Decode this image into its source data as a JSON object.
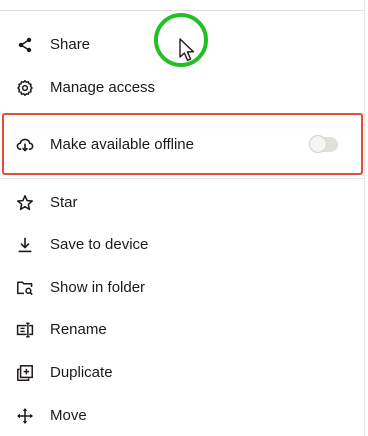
{
  "menu": {
    "items": [
      {
        "label": "Share",
        "icon": "share-icon"
      },
      {
        "label": "Manage access",
        "icon": "gear-icon"
      },
      {
        "label": "Make available offline",
        "icon": "cloud-download-icon",
        "toggle_on": false
      },
      {
        "label": "Star",
        "icon": "star-icon"
      },
      {
        "label": "Save to device",
        "icon": "download-icon"
      },
      {
        "label": "Show in folder",
        "icon": "folder-search-icon"
      },
      {
        "label": "Rename",
        "icon": "rename-icon"
      },
      {
        "label": "Duplicate",
        "icon": "duplicate-icon"
      },
      {
        "label": "Move",
        "icon": "move-icon"
      }
    ]
  },
  "annotations": {
    "highlight_color": "#e05038",
    "click_ring_color": "#22c026"
  },
  "colors": {
    "text": "#1e1919",
    "toggle_track": "#e2e0dd"
  }
}
